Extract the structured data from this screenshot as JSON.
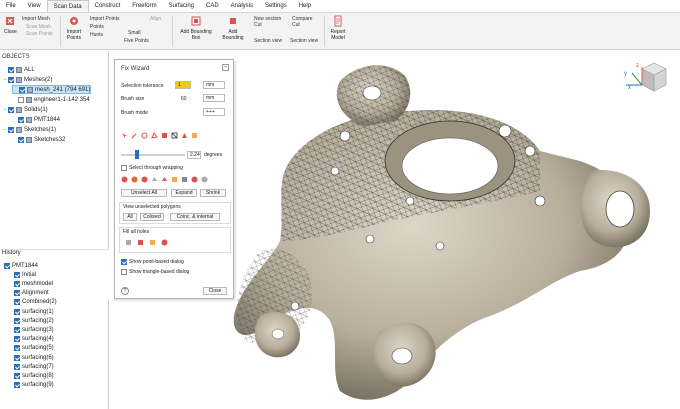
{
  "menu": {
    "tabs": [
      "File",
      "View",
      "Scan Data",
      "Construct",
      "Freeform",
      "Surfacing",
      "CAD",
      "Analysis",
      "Settings",
      "Help"
    ],
    "active_index": 2
  },
  "ribbon": {
    "close": "Close",
    "import_mesh": "Import Mesh",
    "scan_mesh": "Scan Mesh",
    "scan_points": "Scan Points",
    "import_points": "Import Points",
    "import_points2": "Import Points",
    "points": "Points",
    "hunts": "Hunts",
    "small": "Small",
    "five_points": "Five Points",
    "align": "Align",
    "add_bounding_box": "Add Bounding Box",
    "add_bounding": "Add Bounding",
    "new_section_cut": "New section Cut",
    "section_view": "Section view",
    "compare_cut": "Compare Cut",
    "section_view2": "Section view",
    "report_model": "Report Model"
  },
  "objects": {
    "title": "OBJECTS",
    "items": [
      {
        "label": "ALL",
        "level": 0,
        "checked": true,
        "expand": ""
      },
      {
        "label": "Meshes(2)",
        "level": 0,
        "checked": true,
        "expand": "-"
      },
      {
        "label": "mesh_241 (794 691)",
        "level": 1,
        "checked": true,
        "expand": "",
        "selected": true
      },
      {
        "label": "engineer1-1-142 354",
        "level": 1,
        "checked": false,
        "expand": ""
      },
      {
        "label": "Solids(1)",
        "level": 0,
        "checked": true,
        "expand": "-"
      },
      {
        "label": "PMT1844",
        "level": 1,
        "checked": true,
        "expand": ""
      },
      {
        "label": "Sketches(1)",
        "level": 0,
        "checked": true,
        "expand": "-"
      },
      {
        "label": "Sketches32",
        "level": 1,
        "checked": true,
        "expand": ""
      }
    ]
  },
  "history": {
    "title": "History",
    "items": [
      "PMT1844",
      "Initial",
      "meshmodel",
      "Alignment",
      "Combined(2)",
      "surfacing(1)",
      "surfacing(2)",
      "surfacing(3)",
      "surfacing(4)",
      "surfacing(5)",
      "surfacing(6)",
      "surfacing(7)",
      "surfacing(8)",
      "surfacing(9)"
    ]
  },
  "dialog": {
    "title": "Fix Wizard",
    "selection_tolerance_label": "Selection tolerance",
    "selection_tolerance_value": "1",
    "selection_tolerance_unit": "mm",
    "brush_size_label": "Brush size",
    "brush_size_value": "60",
    "brush_size_unit": "mm",
    "brush_mode_label": "Brush mode",
    "brush_mode_value": "+++",
    "slider_value": "2.24",
    "slider_unit": "degrees",
    "select_through_label": "Select through wrapping",
    "unselect_all": "Unselect All",
    "expand": "Expand",
    "shrink": "Shrink",
    "view_unselected": "View unselected polygons",
    "all": "All",
    "colored": "Colored",
    "coinc_internal": "Coinc. & internal",
    "fill_all_holes": "Fill all holes",
    "show_point_based": "Show point-based dialog",
    "show_triangle_based": "Show triangle-based dialog",
    "close": "Close",
    "help": "?",
    "accent": "#f5c518"
  },
  "axes": {
    "x": "x",
    "y": "y",
    "z": "z"
  }
}
